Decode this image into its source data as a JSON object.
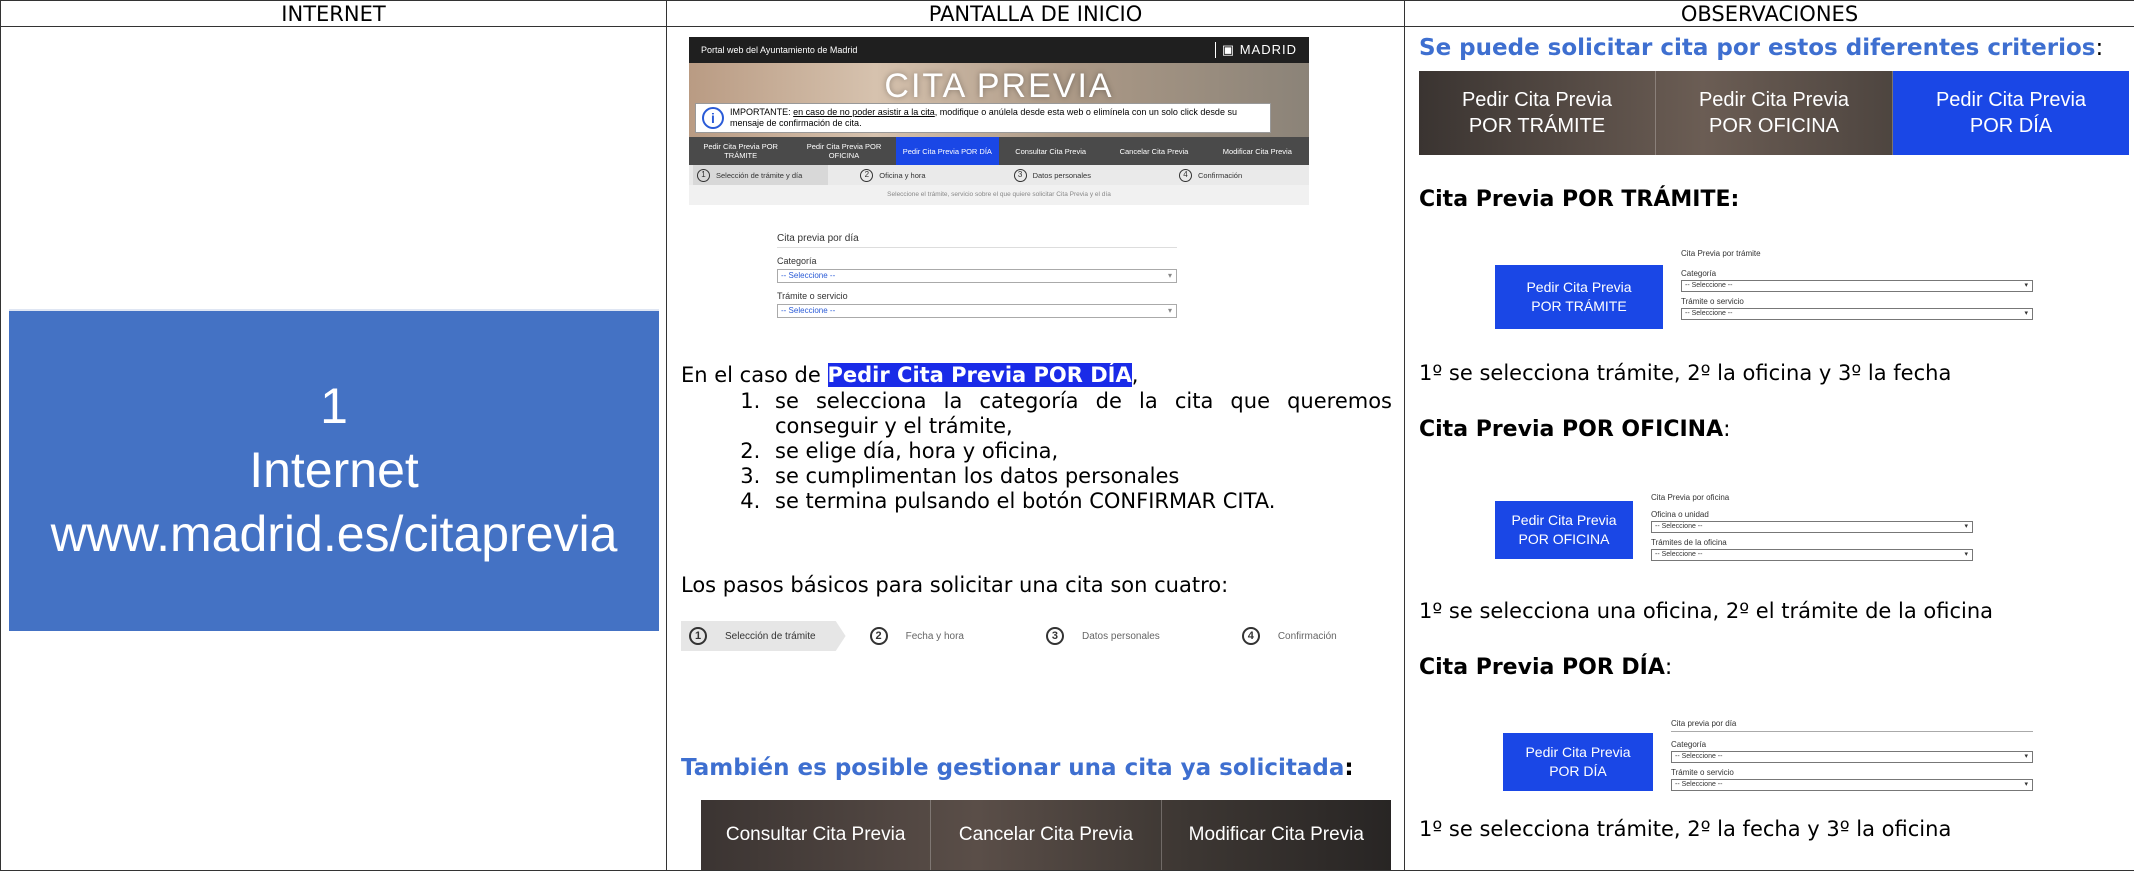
{
  "headers": {
    "c1": "INTERNET",
    "c2": "PANTALLA DE INICIO",
    "c3": "OBSERVACIONES"
  },
  "col1": {
    "number": "1",
    "title": "Internet",
    "url": "www.madrid.es/citaprevia"
  },
  "shot": {
    "topbar_left": "Portal web del Ayuntamiento de Madrid",
    "topbar_right": "MADRID",
    "hero_title": "CITA PREVIA",
    "important_prefix": "IMPORTANTE: ",
    "important_link": "en caso de no poder asistir a la cita",
    "important_text": ", modifique o anúlela desde esta web o elimínela con un solo click desde su mensaje de confirmación de cita.",
    "tabs": [
      "Pedir Cita Previa POR TRÁMITE",
      "Pedir Cita Previa POR OFICINA",
      "Pedir Cita Previa POR DÍA",
      "Consultar Cita Previa",
      "Cancelar Cita Previa",
      "Modificar Cita Previa"
    ],
    "steps": [
      "Selección de trámite y día",
      "Oficina y hora",
      "Datos personales",
      "Confirmación"
    ],
    "note": "Seleccione el trámite, servicio sobre el que quiere solicitar Cita Previa y el día",
    "form_title": "Cita previa por día",
    "label1": "Categoría",
    "label2": "Trámite o servicio",
    "select": "-- Seleccione --"
  },
  "col2": {
    "intro_prefix": "En el caso de ",
    "intro_highlight": "Pedir Cita Previa POR DÍA",
    "intro_suffix": ",",
    "list": [
      "se selecciona la categoría de la cita que queremos conseguir y el trámite,",
      "se elige día, hora y oficina,",
      "se cumplimentan los datos personales",
      "se termina pulsando el botón CONFIRMAR CITA."
    ],
    "basic": "Los pasos básicos para solicitar una cita son cuatro:",
    "progress": [
      "Selección de trámite",
      "Fecha y hora",
      "Datos personales",
      "Confirmación"
    ],
    "manage": "También es posible gestionar una cita ya solicitada",
    "manage_colon": ":",
    "buttons": [
      "Consultar Cita Previa",
      "Cancelar Cita Previa",
      "Modificar Cita Previa"
    ]
  },
  "col3": {
    "criteria": "Se puede solicitar cita por estos diferentes criterios",
    "criteria_colon": ":",
    "big_buttons": [
      [
        "Pedir Cita Previa",
        "POR TRÁMITE"
      ],
      [
        "Pedir Cita Previa",
        "POR OFICINA"
      ],
      [
        "Pedir Cita Previa",
        "POR DÍA"
      ]
    ],
    "sec1": "Cita Previa POR TRÁMITE:",
    "sec1_form_title": "Cita Previa por trámite",
    "sec1_l1": "Categoría",
    "sec1_l2": "Trámite o servicio",
    "sec1_result": "1º se selecciona trámite, 2º la oficina y 3º la fecha",
    "sec2": "Cita Previa POR OFICINA",
    "sec2_colon": ":",
    "sec2_form_title": "Cita Previa por oficina",
    "sec2_l1": "Oficina o unidad",
    "sec2_l2": "Trámites de la oficina",
    "sec2_result": "1º se selecciona una oficina, 2º el trámite de la oficina",
    "sec3": "Cita Previa POR DÍA",
    "sec3_colon": ":",
    "sec3_form_title": "Cita previa por día",
    "sec3_l1": "Categoría",
    "sec3_l2": "Trámite o servicio",
    "sec3_result": "1º se selecciona trámite, 2º la fecha y 3º la oficina",
    "select": "-- Seleccione --",
    "btn_line1": "Pedir Cita Previa"
  },
  "colors": {
    "accent_blue": "#1a47e6",
    "box_blue": "#4472c4",
    "title_blue": "#3e6fd0"
  }
}
